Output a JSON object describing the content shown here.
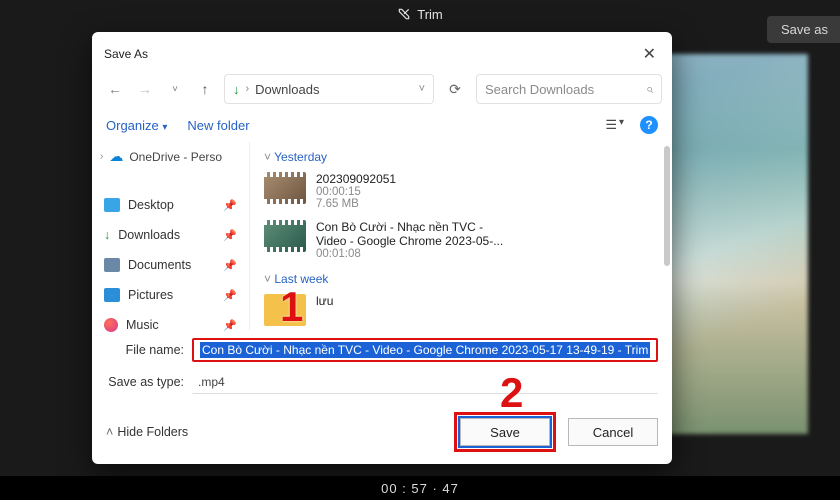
{
  "app": {
    "title": "Trim",
    "save_as_pill": "Save as"
  },
  "timecode": "00 : 57 · 47",
  "dialog": {
    "title": "Save As",
    "path": "Downloads",
    "search_placeholder": "Search Downloads",
    "toolbar": {
      "organize": "Organize",
      "newfolder": "New folder",
      "help": "?"
    },
    "sidebar": {
      "top": "OneDrive - Perso",
      "items": [
        {
          "label": "Desktop"
        },
        {
          "label": "Downloads"
        },
        {
          "label": "Documents"
        },
        {
          "label": "Pictures"
        },
        {
          "label": "Music"
        }
      ]
    },
    "groups": [
      {
        "title": "Yesterday",
        "files": [
          {
            "name": "202309092051",
            "dur": "00:00:15",
            "size": "7.65 MB"
          },
          {
            "name_l1": "Con Bò Cười - Nhạc nền TVC -",
            "name_l2": "Video - Google Chrome 2023-05-...",
            "dur": "00:01:08"
          }
        ]
      },
      {
        "title": "Last week",
        "files": [
          {
            "name": "lưu"
          }
        ]
      }
    ],
    "fields": {
      "filename_label": "File name:",
      "filename_value": "Con Bò Cười - Nhạc nền TVC - Video - Google Chrome 2023-05-17 13-49-19 - Trim",
      "type_label": "Save as type:",
      "type_value": ".mp4"
    },
    "footer": {
      "hide": "Hide Folders",
      "save": "Save",
      "cancel": "Cancel"
    }
  },
  "callouts": {
    "one": "1",
    "two": "2"
  }
}
